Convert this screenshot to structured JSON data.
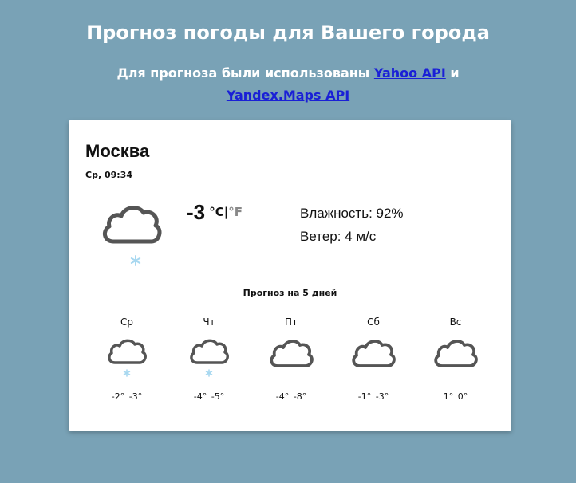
{
  "header": {
    "title": "Прогноз погоды для Вашего города",
    "subtitle_prefix": "Для прогноза были использованы ",
    "link_yahoo": "Yahoo API",
    "subtitle_middle": " и ",
    "link_yandex": "Yandex.Maps API"
  },
  "current": {
    "city": "Москва",
    "datetime": "Ср, 09:34",
    "icon": "cloud-snow-icon",
    "temp": "-3",
    "unit_c": "°C",
    "unit_sep": "|",
    "unit_f": "°F",
    "humidity": "Влажность: 92%",
    "wind": "Ветер: 4 м/с"
  },
  "forecast": {
    "title": "Прогноз на 5 дней",
    "days": [
      {
        "name": "Ср",
        "icon": "cloud-snow-icon",
        "temps": "-2°  -3°"
      },
      {
        "name": "Чт",
        "icon": "cloud-snow-icon",
        "temps": "-4°  -5°"
      },
      {
        "name": "Пт",
        "icon": "cloud-icon",
        "temps": "-4°  -8°"
      },
      {
        "name": "Сб",
        "icon": "cloud-icon",
        "temps": "-1°  -3°"
      },
      {
        "name": "Вс",
        "icon": "cloud-icon",
        "temps": "1°  0°"
      }
    ]
  },
  "colors": {
    "background": "#79a2b6",
    "link": "#1a20d6",
    "icon_stroke": "#555555",
    "snowflake": "#a8d8f0"
  }
}
